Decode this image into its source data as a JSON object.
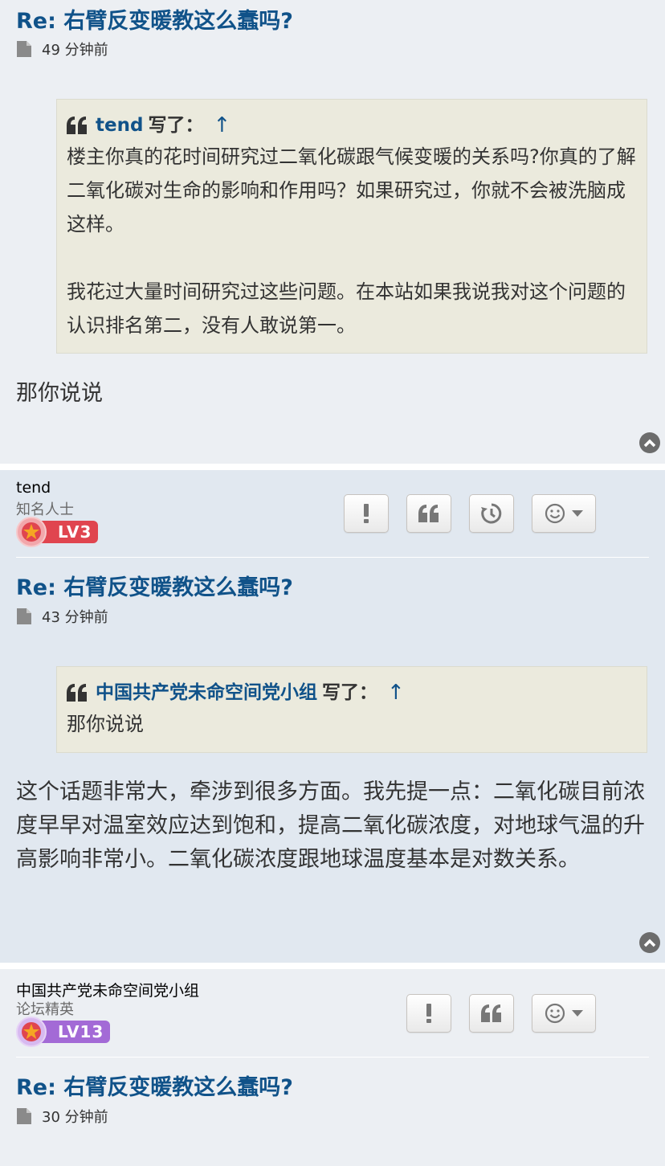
{
  "posts": [
    {
      "title": "Re: 右臂反变暖教这么蠢吗?",
      "time": "49 分钟前",
      "quote": {
        "author": "tend",
        "wrote": "写了：",
        "arrow": "↑",
        "text": "楼主你真的花时间研究过二氧化碳跟气候变暖的关系吗?你真的了解二氧化碳对生命的影响和作用吗？如果研究过，你就不会被洗脑成这样。\n\n我花过大量时间研究过这些问题。在本站如果我说我对这个问题的认识排名第二，没有人敢说第一。"
      },
      "body": "那你说说"
    },
    {
      "user": {
        "name": "tend",
        "rank": "知名人士",
        "level": "LV3"
      },
      "title": "Re: 右臂反变暖教这么蠢吗?",
      "time": "43 分钟前",
      "quote": {
        "author": "中国共产党未命空间党小组",
        "wrote": "写了：",
        "arrow": "↑",
        "text": "那你说说"
      },
      "body": "这个话题非常大，牵涉到很多方面。我先提一点：二氧化碳目前浓度早早对温室效应达到饱和，提高二氧化碳浓度，对地球气温的升高影响非常小。二氧化碳浓度跟地球温度基本是对数关系。"
    },
    {
      "user": {
        "name": "中国共产党未命空间党小组",
        "rank": "论坛精英",
        "level": "LV13"
      },
      "title": "Re: 右臂反变暖教这么蠢吗?",
      "time": "30 分钟前"
    }
  ],
  "icons": {
    "report": "exclamation-icon",
    "quote": "quote-icon",
    "history": "history-icon",
    "reaction": "smiley-icon",
    "top": "chevron-up-icon",
    "file": "file-icon"
  },
  "colors": {
    "title": "#105289",
    "post_bg_1": "#eceff3",
    "post_bg_2": "#e1e8f0",
    "quote_bg": "#ebeadd",
    "lv3_badge": "#e0454f",
    "lv13_badge": "#a36ad6"
  }
}
